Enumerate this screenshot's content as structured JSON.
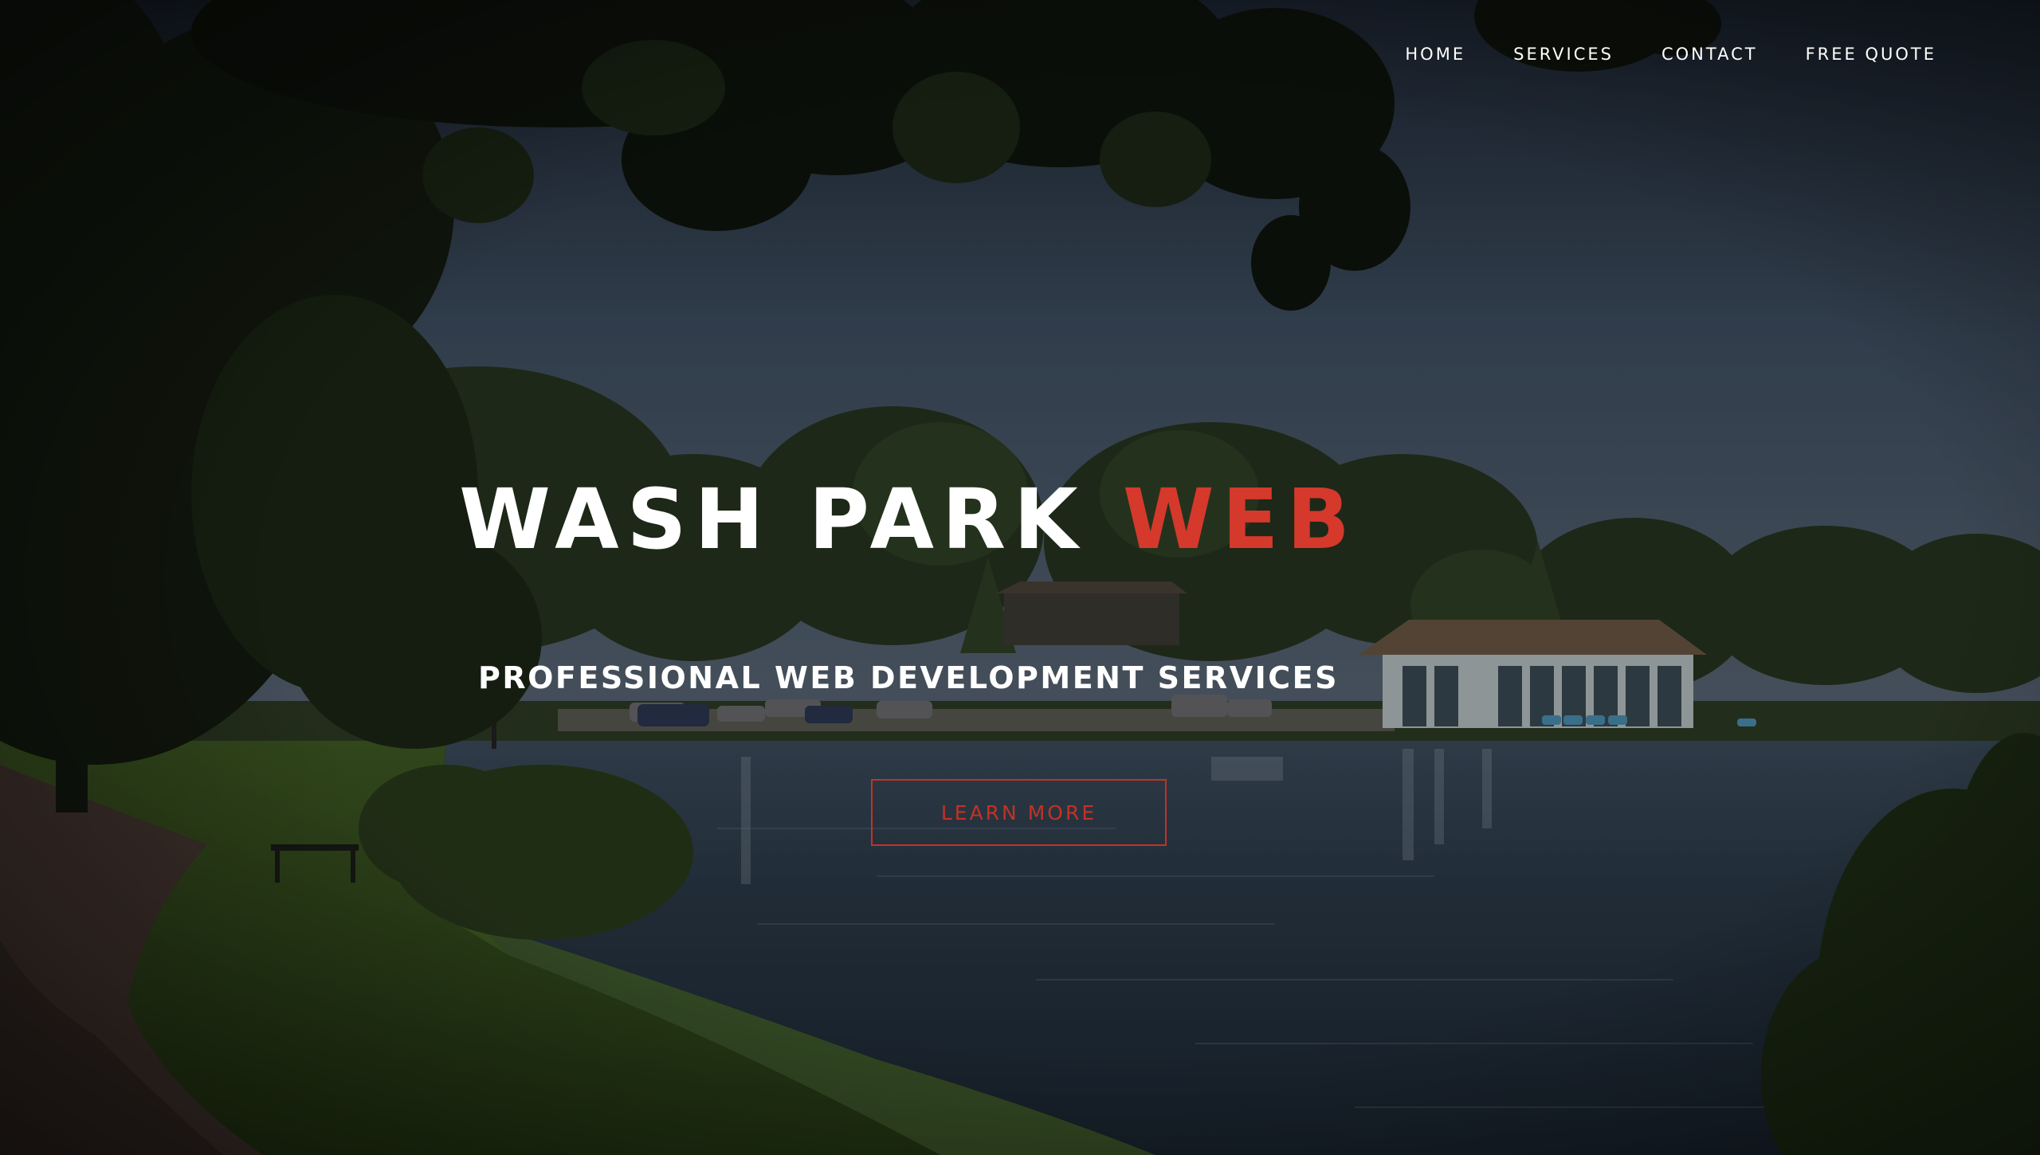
{
  "nav": {
    "items": [
      {
        "label": "HOME"
      },
      {
        "label": "SERVICES"
      },
      {
        "label": "CONTACT"
      },
      {
        "label": "FREE QUOTE"
      }
    ]
  },
  "hero": {
    "title_main": "WASH PARK ",
    "title_accent": "WEB",
    "subtitle": "PROFESSIONAL WEB DEVELOPMENT SERVICES",
    "cta_label": "LEARN MORE"
  },
  "colors": {
    "accent": "#d4392c",
    "button_border": "#c23226",
    "nav_text": "#ffffff"
  }
}
